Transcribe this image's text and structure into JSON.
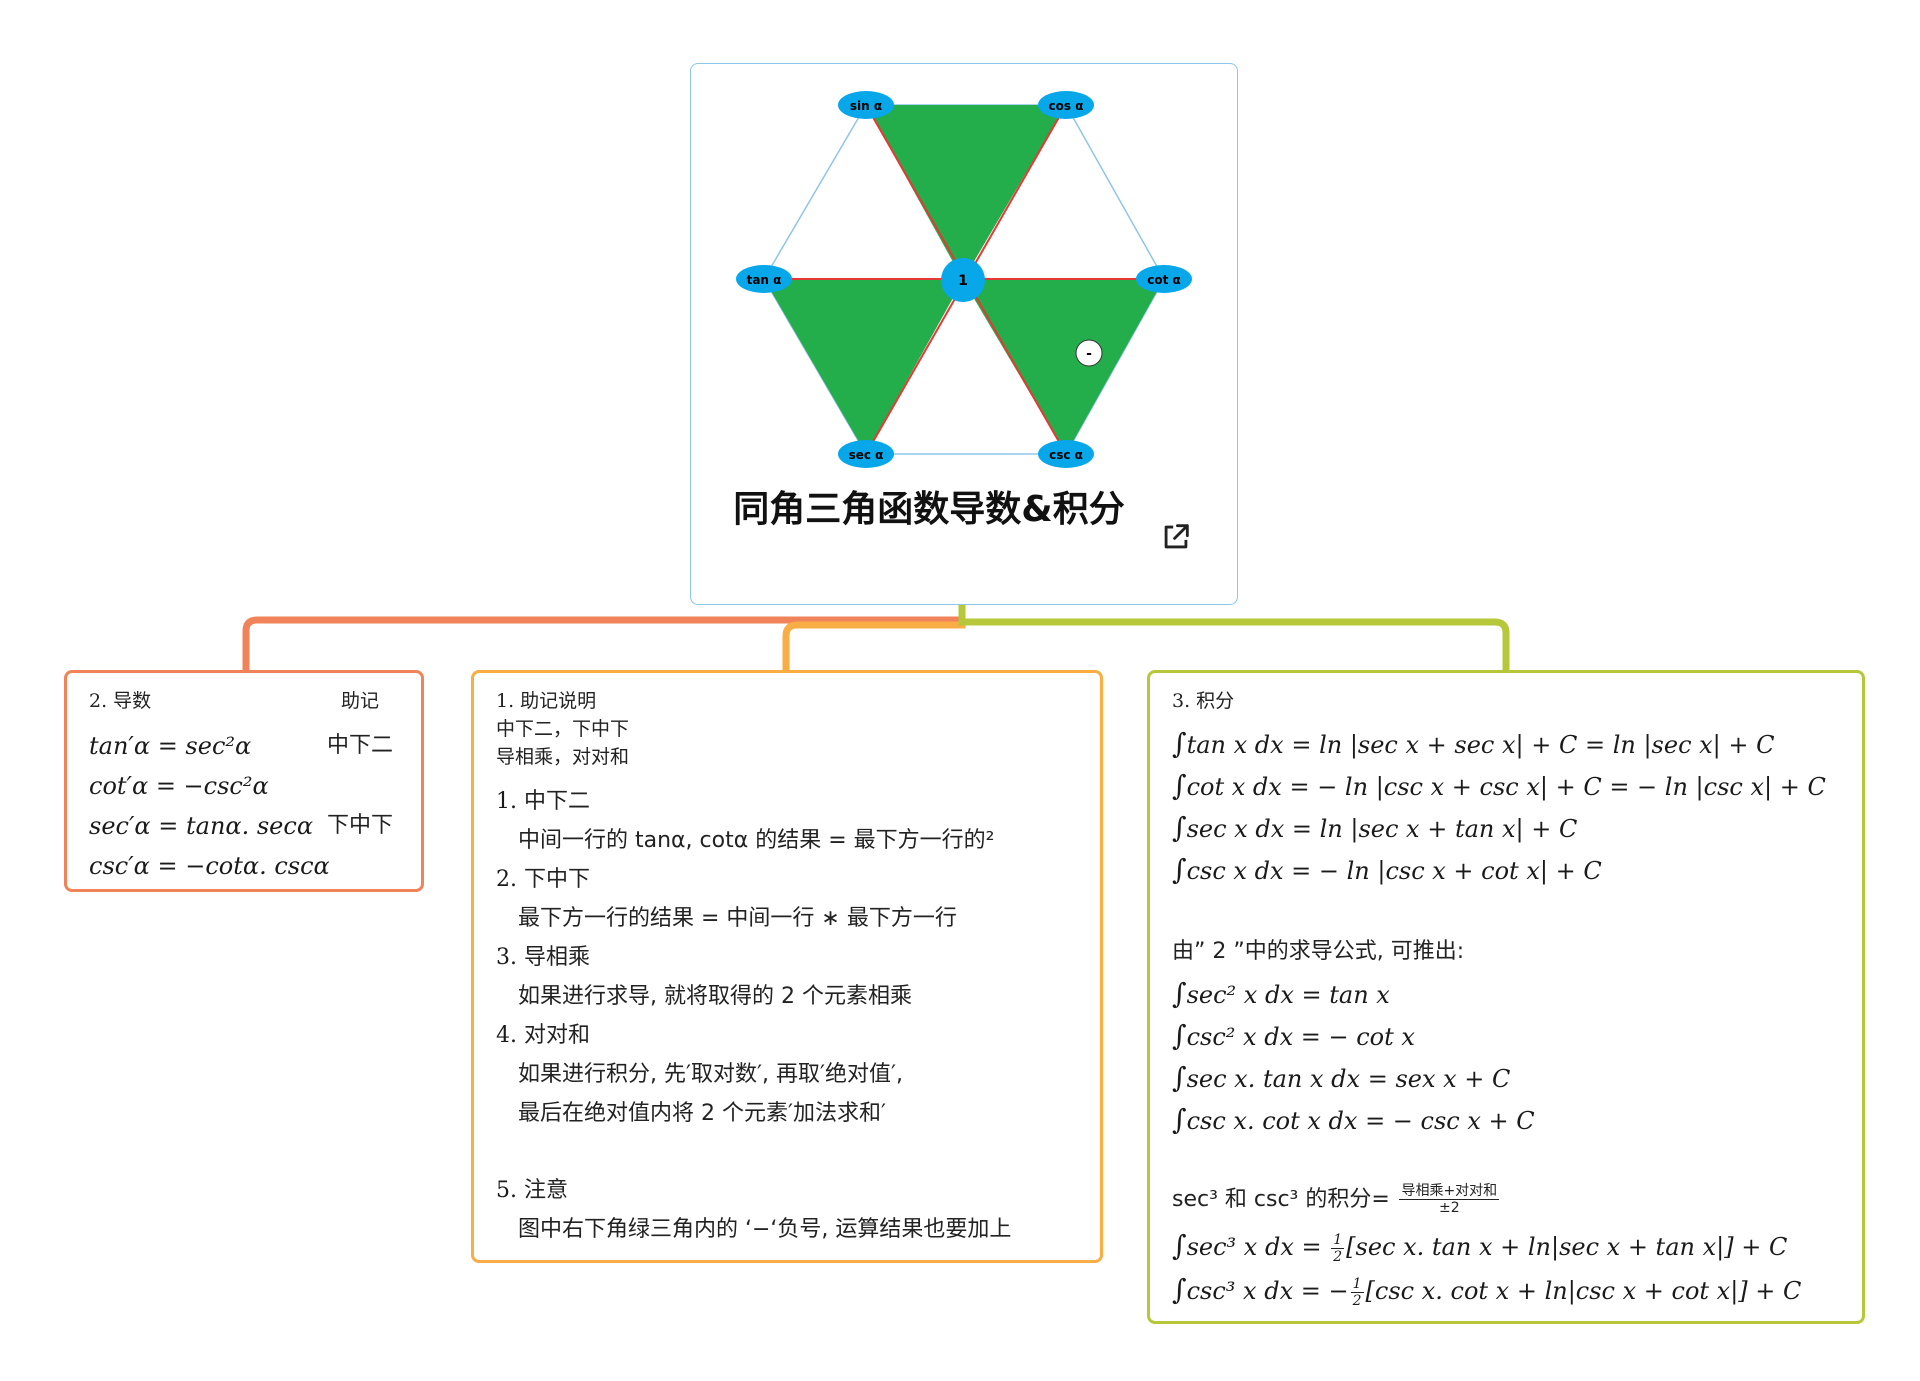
{
  "center": {
    "title": "同角三角函数导数&积分",
    "nodes": {
      "sin": "sin α",
      "cos": "cos α",
      "tan": "tan α",
      "cot": "cot α",
      "sec": "sec α",
      "csc": "csc α",
      "one": "1"
    },
    "minus_marker": "-",
    "colors": {
      "triangle": "#23ad4b",
      "node": "#07a7ea",
      "red_edge": "#e53935",
      "hex_edge": "#8fc5e8"
    },
    "link_icon": "external-link-icon"
  },
  "branches": {
    "derivative": {
      "heading": "2. 导数",
      "mnemonic_heading": "助记",
      "lines": [
        {
          "formula": "tan′α = sec²α",
          "note": "中下二"
        },
        {
          "formula": "cot′α = −csc²α",
          "note": ""
        },
        {
          "formula": "sec′α = tanα. secα",
          "note": "下中下"
        },
        {
          "formula": "csc′α = −cotα. cscα",
          "note": ""
        }
      ],
      "color": "#f08359"
    },
    "mnemonic": {
      "heading_lines": [
        "1. 助记说明",
        "中下二，下中下",
        "导相乘，对对和"
      ],
      "items": [
        {
          "num": "1.",
          "title": "中下二",
          "desc": [
            "中间一行的 tanα, cotα 的结果  =  最下方一行的²"
          ]
        },
        {
          "num": "2.",
          "title": "下中下",
          "desc": [
            "最下方一行的结果  =  中间一行 ∗ 最下方一行"
          ]
        },
        {
          "num": "3.",
          "title": "导相乘",
          "desc": [
            "如果进行求导, 就将取得的 2 个元素相乘"
          ]
        },
        {
          "num": "4.",
          "title": "对对和",
          "desc": [
            "如果进行积分, 先′取对数′, 再取′绝对值′,",
            "最后在绝对值内将 2 个元素′加法求和′"
          ]
        },
        {
          "num": "5.",
          "title": "注意",
          "desc": [
            "图中右下角绿三角内的 ‘−‘负号, 运算结果也要加上"
          ]
        }
      ],
      "color": "#f9ad45"
    },
    "integral": {
      "heading": "3. 积分",
      "group1": [
        "tan x dx = ln |sec x + sec x| + C = ln |sec x| + C",
        "cot x dx = − ln |csc x + csc x| + C = − ln |csc x| + C",
        "sec x dx = ln |sec x + tan x| + C",
        "csc x dx = − ln |csc x + cot x| + C"
      ],
      "derived_intro": "由” 2 ”中的求导公式, 可推出:",
      "group2": [
        "sec² x dx = tan x",
        "csc² x dx = − cot x",
        "sec x. tan x dx = sex x + C",
        "csc x. cot x dx = − csc x + C"
      ],
      "cube_intro_prefix": "sec³ 和 csc³ 的积分=",
      "cube_frac_num": "导相乘+对对和",
      "cube_frac_den": "±2",
      "cube_sec_lhs": "sec³ x dx = ",
      "cube_sec_rhs": "[sec x. tan x + ln|sec x + tan x|] + C",
      "cube_csc_lhs": "csc³ x dx = −",
      "cube_csc_rhs": "[csc x. cot x + ln|csc x + cot x|] + C",
      "half_num": "1",
      "half_den": "2",
      "color": "#b6c83a"
    }
  }
}
